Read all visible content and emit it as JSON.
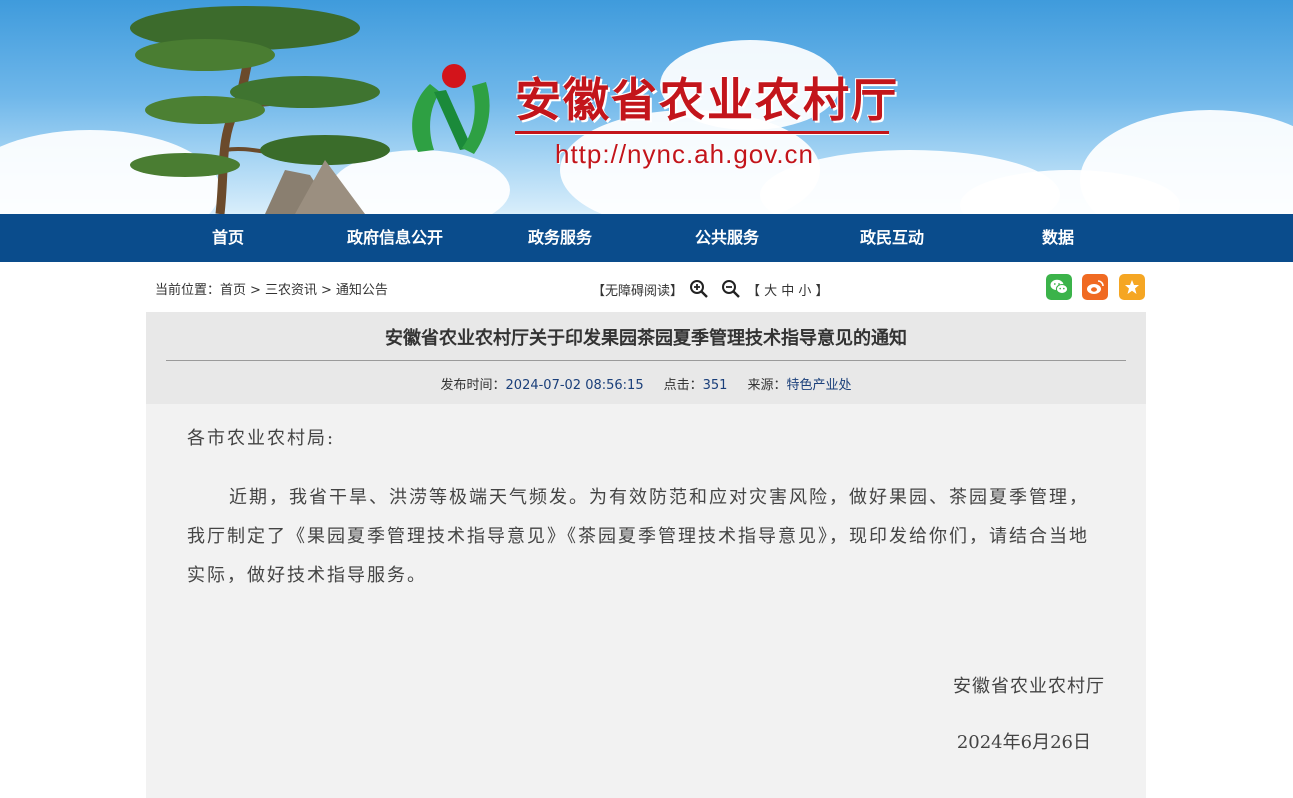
{
  "header": {
    "site_title": "安徽省农业农村厅",
    "site_url": "http://nync.ah.gov.cn"
  },
  "nav": {
    "items": [
      "首页",
      "政府信息公开",
      "政务服务",
      "公共服务",
      "政民互动",
      "数据"
    ]
  },
  "breadcrumb": {
    "prefix": "当前位置：",
    "items": [
      "首页",
      "三农资讯",
      "通知公告"
    ],
    "separator": ">"
  },
  "accessibility": {
    "reader_label": "【无障碍阅读】",
    "font_size_label": "【 大 中 小 】"
  },
  "share": {
    "icons": [
      "wechat-icon",
      "weibo-icon",
      "favorite-star-icon"
    ],
    "colors": {
      "wechat": "#3bb34a",
      "weibo": "#f06a22",
      "favorite": "#f5a623"
    }
  },
  "article": {
    "title": "安徽省农业农村厅关于印发果园茶园夏季管理技术指导意见的通知",
    "meta": {
      "publish_label": "发布时间：",
      "publish_value": "2024-07-02 08:56:15",
      "clicks_label": "点击：",
      "clicks_value": "351",
      "source_label": "来源：",
      "source_value": "特色产业处"
    },
    "salutation": "各市农业农村局:",
    "paragraph": "近期，我省干旱、洪涝等极端天气频发。为有效防范和应对灾害风险，做好果园、茶园夏季管理，我厅制定了《果园夏季管理技术指导意见》《茶园夏季管理技术指导意见》，现印发给你们，请结合当地实际，做好技术指导服务。",
    "signer": "安徽省农业农村厅",
    "date": "2024年6月26日"
  },
  "colors": {
    "nav_bg": "#0a4c8c",
    "brand_red": "#c3151b",
    "meta_value": "#1a3f7a"
  }
}
